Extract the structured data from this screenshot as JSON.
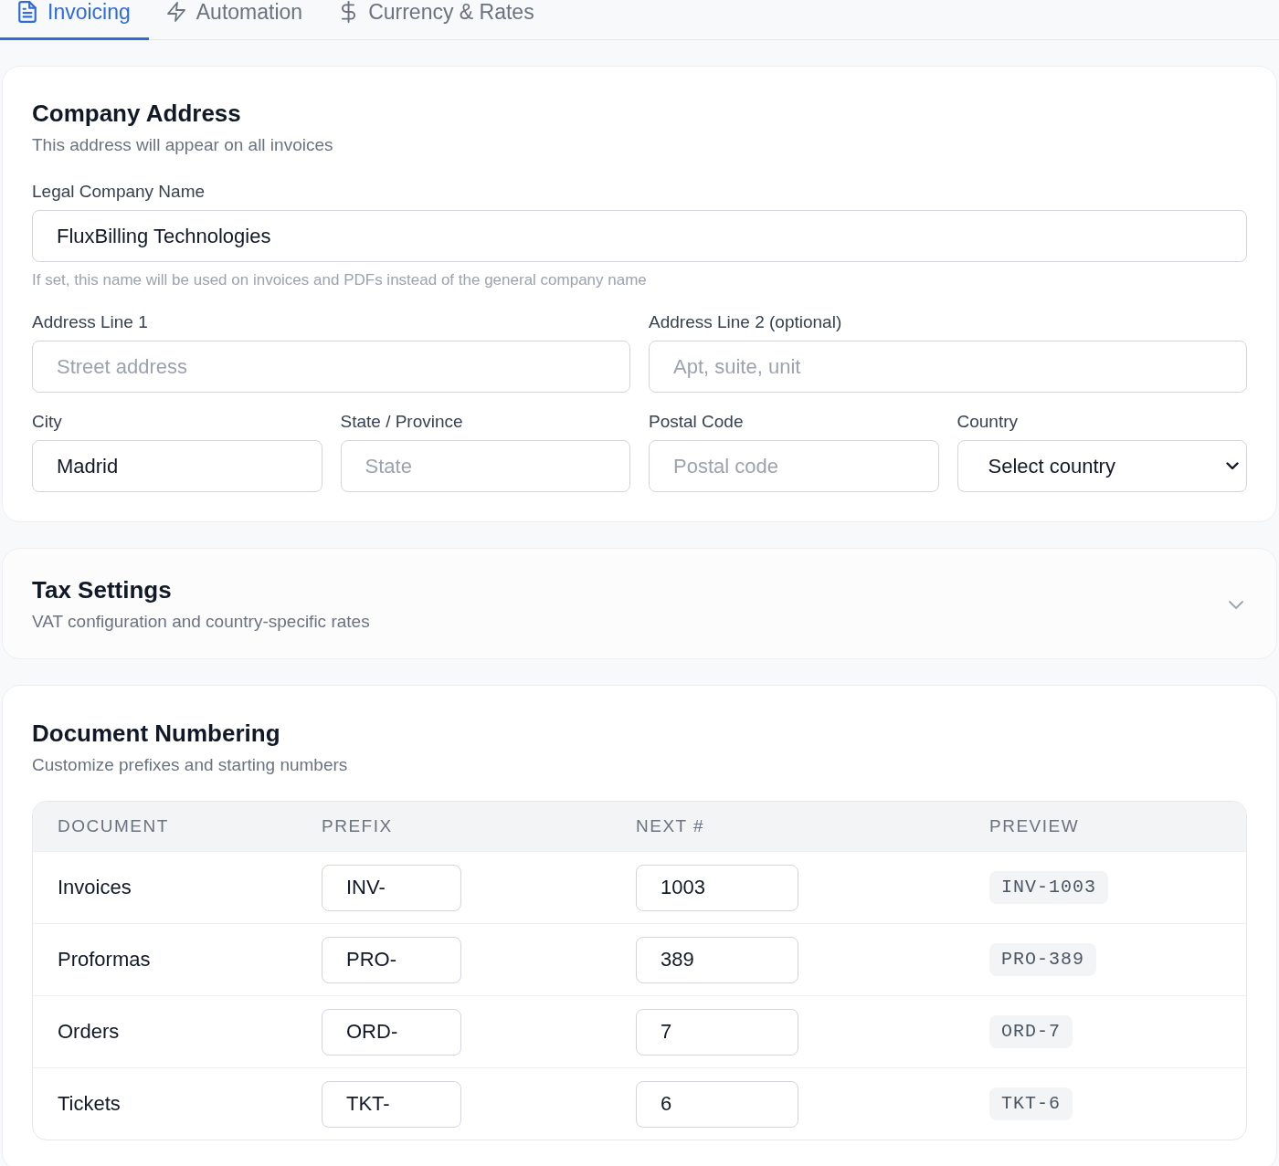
{
  "tabs": [
    {
      "label": "Invoicing",
      "selected": true
    },
    {
      "label": "Automation",
      "selected": false
    },
    {
      "label": "Currency & Rates",
      "selected": false
    }
  ],
  "company_address": {
    "title": "Company Address",
    "subtitle": "This address will appear on all invoices",
    "legal_name": {
      "label": "Legal Company Name",
      "kind": "text",
      "value": "FluxBilling Technologies",
      "help": "If set, this name will be used on invoices and PDFs instead of the general company name"
    },
    "street_fields": [
      {
        "label": "Address Line 1",
        "kind": "text",
        "placeholder": "Street address"
      },
      {
        "label": "Address Line 2 (optional)",
        "kind": "text",
        "placeholder": "Apt, suite, unit"
      }
    ],
    "locality_fields": [
      {
        "label": "City",
        "kind": "text",
        "value": "Madrid"
      },
      {
        "label": "State / Province",
        "kind": "text",
        "placeholder": "State"
      },
      {
        "label": "Postal Code",
        "kind": "text",
        "placeholder": "Postal code"
      },
      {
        "label": "Country",
        "kind": "select",
        "value": "Select country"
      }
    ]
  },
  "tax_settings": {
    "title": "Tax Settings",
    "subtitle": "VAT configuration and country-specific rates",
    "expanded": false
  },
  "document_numbering": {
    "title": "Document Numbering",
    "subtitle": "Customize prefixes and starting numbers",
    "table": {
      "columns": [
        "DOCUMENT",
        "PREFIX",
        "NEXT #",
        "PREVIEW"
      ],
      "rows": [
        {
          "document": "Invoices",
          "prefix": "INV-",
          "next": "1003",
          "preview": "INV-1003"
        },
        {
          "document": "Proformas",
          "prefix": "PRO-",
          "next": "389",
          "preview": "PRO-389"
        },
        {
          "document": "Orders",
          "prefix": "ORD-",
          "next": "7",
          "preview": "ORD-7"
        },
        {
          "document": "Tickets",
          "prefix": "TKT-",
          "next": "6",
          "preview": "TKT-6"
        }
      ]
    }
  }
}
